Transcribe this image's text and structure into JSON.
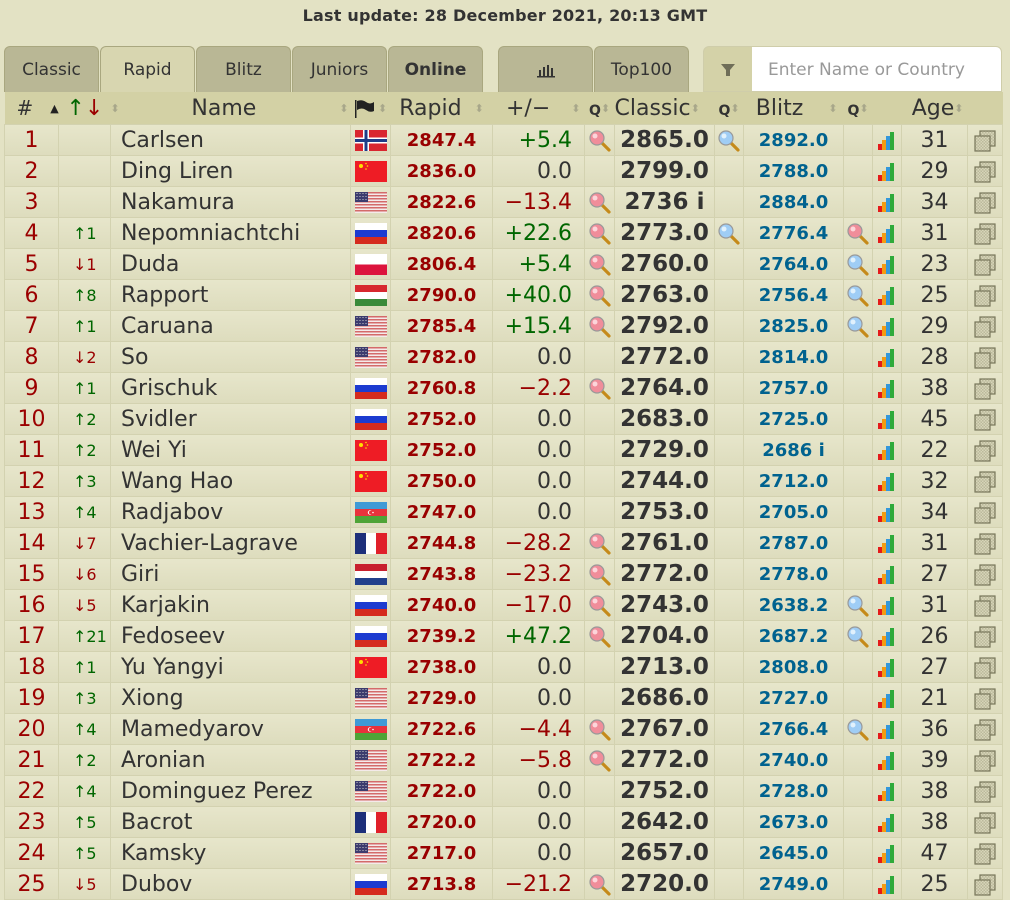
{
  "header": {
    "last_update": "Last update: 28 December 2021, 20:13 GMT"
  },
  "tabs": [
    {
      "label": "Classic",
      "active": false,
      "bold": false
    },
    {
      "label": "Rapid",
      "active": true,
      "bold": false
    },
    {
      "label": "Blitz",
      "active": false,
      "bold": false
    },
    {
      "label": "Juniors",
      "active": false,
      "bold": false
    },
    {
      "label": "Online",
      "active": false,
      "bold": true
    },
    {
      "label": "",
      "icon": "bar-chart-icon",
      "active": false,
      "bold": false
    },
    {
      "label": "Top100",
      "active": false,
      "bold": false
    }
  ],
  "search": {
    "placeholder": "Enter Name or Country",
    "value": "",
    "icon": "filter-icon"
  },
  "columns": {
    "rank": "#",
    "change_up": "↑",
    "change_down": "↓",
    "name": "Name",
    "flag_icon": "flag-icon",
    "rapid": "Rapid",
    "diff": "+/−",
    "classic": "Classic",
    "blitz": "Blitz",
    "age": "Age"
  },
  "colors": {
    "rank": "#9b0000",
    "rapid": "#990000",
    "blitz": "#00628f",
    "positive": "#006600",
    "negative": "#990000",
    "background": "#e3e2c4",
    "header": "#d3d1a5"
  },
  "rows": [
    {
      "rank": "1",
      "chg_dir": "",
      "chg": "",
      "name": "Carlsen",
      "country": "NOR",
      "rapid": "2847.4",
      "diff": "+5.4",
      "diff_sign": "pos",
      "rapid_mag": "red",
      "classic": "2865.0",
      "classic_mag": "blue",
      "blitz": "2892.0",
      "blitz_mag": "",
      "age": "31"
    },
    {
      "rank": "2",
      "chg_dir": "",
      "chg": "",
      "name": "Ding Liren",
      "country": "CHN",
      "rapid": "2836.0",
      "diff": "0.0",
      "diff_sign": "zero",
      "rapid_mag": "",
      "classic": "2799.0",
      "classic_mag": "",
      "blitz": "2788.0",
      "blitz_mag": "",
      "age": "29"
    },
    {
      "rank": "3",
      "chg_dir": "",
      "chg": "",
      "name": "Nakamura",
      "country": "USA",
      "rapid": "2822.6",
      "diff": "−13.4",
      "diff_sign": "neg",
      "rapid_mag": "red",
      "classic": "2736 i",
      "classic_mag": "",
      "blitz": "2884.0",
      "blitz_mag": "",
      "age": "34"
    },
    {
      "rank": "4",
      "chg_dir": "up",
      "chg": "1",
      "name": "Nepomniachtchi",
      "country": "RUS",
      "rapid": "2820.6",
      "diff": "+22.6",
      "diff_sign": "pos",
      "rapid_mag": "red",
      "classic": "2773.0",
      "classic_mag": "blue",
      "blitz": "2776.4",
      "blitz_mag": "red",
      "age": "31"
    },
    {
      "rank": "5",
      "chg_dir": "down",
      "chg": "1",
      "name": "Duda",
      "country": "POL",
      "rapid": "2806.4",
      "diff": "+5.4",
      "diff_sign": "pos",
      "rapid_mag": "red",
      "classic": "2760.0",
      "classic_mag": "",
      "blitz": "2764.0",
      "blitz_mag": "blue",
      "age": "23"
    },
    {
      "rank": "6",
      "chg_dir": "up",
      "chg": "8",
      "name": "Rapport",
      "country": "HUN",
      "rapid": "2790.0",
      "diff": "+40.0",
      "diff_sign": "pos",
      "rapid_mag": "red",
      "classic": "2763.0",
      "classic_mag": "",
      "blitz": "2756.4",
      "blitz_mag": "blue",
      "age": "25"
    },
    {
      "rank": "7",
      "chg_dir": "up",
      "chg": "1",
      "name": "Caruana",
      "country": "USA",
      "rapid": "2785.4",
      "diff": "+15.4",
      "diff_sign": "pos",
      "rapid_mag": "red",
      "classic": "2792.0",
      "classic_mag": "",
      "blitz": "2825.0",
      "blitz_mag": "blue",
      "age": "29"
    },
    {
      "rank": "8",
      "chg_dir": "down",
      "chg": "2",
      "name": "So",
      "country": "USA",
      "rapid": "2782.0",
      "diff": "0.0",
      "diff_sign": "zero",
      "rapid_mag": "",
      "classic": "2772.0",
      "classic_mag": "",
      "blitz": "2814.0",
      "blitz_mag": "",
      "age": "28"
    },
    {
      "rank": "9",
      "chg_dir": "up",
      "chg": "1",
      "name": "Grischuk",
      "country": "RUS",
      "rapid": "2760.8",
      "diff": "−2.2",
      "diff_sign": "neg",
      "rapid_mag": "red",
      "classic": "2764.0",
      "classic_mag": "",
      "blitz": "2757.0",
      "blitz_mag": "",
      "age": "38"
    },
    {
      "rank": "10",
      "chg_dir": "up",
      "chg": "2",
      "name": "Svidler",
      "country": "RUS",
      "rapid": "2752.0",
      "diff": "0.0",
      "diff_sign": "zero",
      "rapid_mag": "",
      "classic": "2683.0",
      "classic_mag": "",
      "blitz": "2725.0",
      "blitz_mag": "",
      "age": "45"
    },
    {
      "rank": "11",
      "chg_dir": "up",
      "chg": "2",
      "name": "Wei Yi",
      "country": "CHN",
      "rapid": "2752.0",
      "diff": "0.0",
      "diff_sign": "zero",
      "rapid_mag": "",
      "classic": "2729.0",
      "classic_mag": "",
      "blitz": "2686 i",
      "blitz_mag": "",
      "age": "22"
    },
    {
      "rank": "12",
      "chg_dir": "up",
      "chg": "3",
      "name": "Wang Hao",
      "country": "CHN",
      "rapid": "2750.0",
      "diff": "0.0",
      "diff_sign": "zero",
      "rapid_mag": "",
      "classic": "2744.0",
      "classic_mag": "",
      "blitz": "2712.0",
      "blitz_mag": "",
      "age": "32"
    },
    {
      "rank": "13",
      "chg_dir": "up",
      "chg": "4",
      "name": "Radjabov",
      "country": "AZE",
      "rapid": "2747.0",
      "diff": "0.0",
      "diff_sign": "zero",
      "rapid_mag": "",
      "classic": "2753.0",
      "classic_mag": "",
      "blitz": "2705.0",
      "blitz_mag": "",
      "age": "34"
    },
    {
      "rank": "14",
      "chg_dir": "down",
      "chg": "7",
      "name": "Vachier-Lagrave",
      "country": "FRA",
      "rapid": "2744.8",
      "diff": "−28.2",
      "diff_sign": "neg",
      "rapid_mag": "red",
      "classic": "2761.0",
      "classic_mag": "",
      "blitz": "2787.0",
      "blitz_mag": "",
      "age": "31"
    },
    {
      "rank": "15",
      "chg_dir": "down",
      "chg": "6",
      "name": "Giri",
      "country": "NED",
      "rapid": "2743.8",
      "diff": "−23.2",
      "diff_sign": "neg",
      "rapid_mag": "red",
      "classic": "2772.0",
      "classic_mag": "",
      "blitz": "2778.0",
      "blitz_mag": "",
      "age": "27"
    },
    {
      "rank": "16",
      "chg_dir": "down",
      "chg": "5",
      "name": "Karjakin",
      "country": "RUS",
      "rapid": "2740.0",
      "diff": "−17.0",
      "diff_sign": "neg",
      "rapid_mag": "red",
      "classic": "2743.0",
      "classic_mag": "",
      "blitz": "2638.2",
      "blitz_mag": "blue",
      "age": "31"
    },
    {
      "rank": "17",
      "chg_dir": "up",
      "chg": "21",
      "name": "Fedoseev",
      "country": "RUS",
      "rapid": "2739.2",
      "diff": "+47.2",
      "diff_sign": "pos",
      "rapid_mag": "red",
      "classic": "2704.0",
      "classic_mag": "",
      "blitz": "2687.2",
      "blitz_mag": "blue",
      "age": "26"
    },
    {
      "rank": "18",
      "chg_dir": "up",
      "chg": "1",
      "name": "Yu Yangyi",
      "country": "CHN",
      "rapid": "2738.0",
      "diff": "0.0",
      "diff_sign": "zero",
      "rapid_mag": "",
      "classic": "2713.0",
      "classic_mag": "",
      "blitz": "2808.0",
      "blitz_mag": "",
      "age": "27"
    },
    {
      "rank": "19",
      "chg_dir": "up",
      "chg": "3",
      "name": "Xiong",
      "country": "USA",
      "rapid": "2729.0",
      "diff": "0.0",
      "diff_sign": "zero",
      "rapid_mag": "",
      "classic": "2686.0",
      "classic_mag": "",
      "blitz": "2727.0",
      "blitz_mag": "",
      "age": "21"
    },
    {
      "rank": "20",
      "chg_dir": "up",
      "chg": "4",
      "name": "Mamedyarov",
      "country": "AZE",
      "rapid": "2722.6",
      "diff": "−4.4",
      "diff_sign": "neg",
      "rapid_mag": "red",
      "classic": "2767.0",
      "classic_mag": "",
      "blitz": "2766.4",
      "blitz_mag": "blue",
      "age": "36"
    },
    {
      "rank": "21",
      "chg_dir": "up",
      "chg": "2",
      "name": "Aronian",
      "country": "USA",
      "rapid": "2722.2",
      "diff": "−5.8",
      "diff_sign": "neg",
      "rapid_mag": "red",
      "classic": "2772.0",
      "classic_mag": "",
      "blitz": "2740.0",
      "blitz_mag": "",
      "age": "39"
    },
    {
      "rank": "22",
      "chg_dir": "up",
      "chg": "4",
      "name": "Dominguez Perez",
      "country": "USA",
      "rapid": "2722.0",
      "diff": "0.0",
      "diff_sign": "zero",
      "rapid_mag": "",
      "classic": "2752.0",
      "classic_mag": "",
      "blitz": "2728.0",
      "blitz_mag": "",
      "age": "38"
    },
    {
      "rank": "23",
      "chg_dir": "up",
      "chg": "5",
      "name": "Bacrot",
      "country": "FRA",
      "rapid": "2720.0",
      "diff": "0.0",
      "diff_sign": "zero",
      "rapid_mag": "",
      "classic": "2642.0",
      "classic_mag": "",
      "blitz": "2673.0",
      "blitz_mag": "",
      "age": "38"
    },
    {
      "rank": "24",
      "chg_dir": "up",
      "chg": "5",
      "name": "Kamsky",
      "country": "USA",
      "rapid": "2717.0",
      "diff": "0.0",
      "diff_sign": "zero",
      "rapid_mag": "",
      "classic": "2657.0",
      "classic_mag": "",
      "blitz": "2645.0",
      "blitz_mag": "",
      "age": "47"
    },
    {
      "rank": "25",
      "chg_dir": "down",
      "chg": "5",
      "name": "Dubov",
      "country": "RUS",
      "rapid": "2713.8",
      "diff": "−21.2",
      "diff_sign": "neg",
      "rapid_mag": "red",
      "classic": "2720.0",
      "classic_mag": "",
      "blitz": "2749.0",
      "blitz_mag": "",
      "age": "25"
    }
  ]
}
